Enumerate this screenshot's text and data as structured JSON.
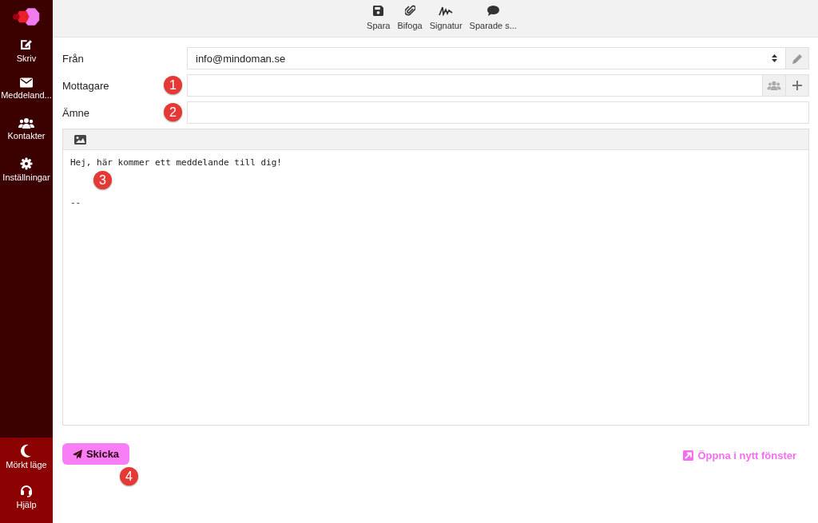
{
  "sidebar": {
    "items": [
      {
        "label": "Skriv"
      },
      {
        "label": "Meddeland..."
      },
      {
        "label": "Kontakter"
      },
      {
        "label": "Inställningar"
      }
    ],
    "bottom_items": [
      {
        "label": "Mörkt läge"
      },
      {
        "label": "Hjälp"
      }
    ]
  },
  "toolbar": {
    "buttons": [
      {
        "label": "Spara"
      },
      {
        "label": "Bifoga"
      },
      {
        "label": "Signatur"
      },
      {
        "label": "Sparade s..."
      }
    ]
  },
  "form": {
    "fields": [
      {
        "kind": "select",
        "label": "Från",
        "value": "info@mindoman.se"
      },
      {
        "kind": "recipients",
        "label": "Mottagare"
      },
      {
        "kind": "text",
        "label": "Ämne"
      }
    ]
  },
  "editor": {
    "lines": [
      "Hej, här kommer ett meddelande till dig!",
      "--"
    ]
  },
  "send_button": "Skicka",
  "open_window_link": "Öppna i nytt fönster",
  "callouts": [
    "1",
    "2",
    "3",
    "4"
  ]
}
